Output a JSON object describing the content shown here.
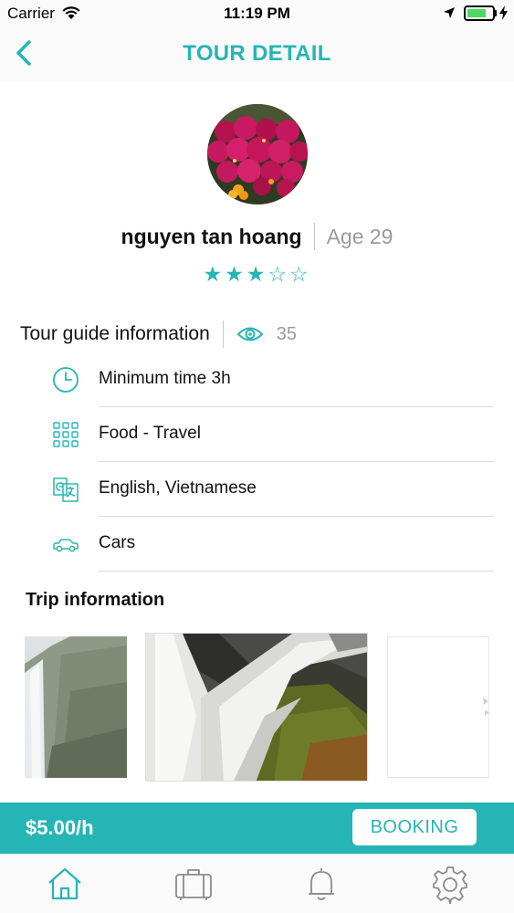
{
  "status_bar": {
    "carrier": "Carrier",
    "time": "11:19 PM"
  },
  "nav": {
    "title": "TOUR DETAIL",
    "back_icon": "chevron-left-icon"
  },
  "profile": {
    "name": "nguyen tan hoang",
    "age": "Age 29",
    "rating": 3,
    "rating_max": 5
  },
  "guide_section": {
    "title": "Tour guide information",
    "view_icon": "eye-icon",
    "views": "35",
    "items": [
      {
        "icon": "clock-icon",
        "label": "Minimum time 3h"
      },
      {
        "icon": "grid-icon",
        "label": "Food - Travel"
      },
      {
        "icon": "translate-icon",
        "label": "English, Vietnamese"
      },
      {
        "icon": "car-icon",
        "label": "Cars"
      }
    ]
  },
  "trip": {
    "title": "Trip information"
  },
  "footer": {
    "price": "$5.00/h",
    "booking_label": "BOOKING"
  },
  "tabs": [
    {
      "icon": "home-icon",
      "active": true
    },
    {
      "icon": "suitcase-icon",
      "active": false
    },
    {
      "icon": "bell-icon",
      "active": false
    },
    {
      "icon": "gear-icon",
      "active": false
    }
  ],
  "colors": {
    "accent": "#26b5b5",
    "muted_text": "#9a9a9a",
    "battery": "#4cd964"
  }
}
